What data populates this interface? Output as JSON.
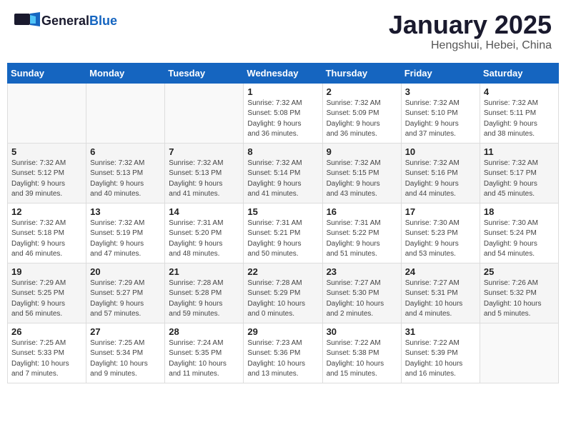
{
  "header": {
    "logo_general": "General",
    "logo_blue": "Blue",
    "month_title": "January 2025",
    "location": "Hengshui, Hebei, China"
  },
  "days_of_week": [
    "Sunday",
    "Monday",
    "Tuesday",
    "Wednesday",
    "Thursday",
    "Friday",
    "Saturday"
  ],
  "weeks": [
    [
      {
        "day": "",
        "info": ""
      },
      {
        "day": "",
        "info": ""
      },
      {
        "day": "",
        "info": ""
      },
      {
        "day": "1",
        "info": "Sunrise: 7:32 AM\nSunset: 5:08 PM\nDaylight: 9 hours\nand 36 minutes."
      },
      {
        "day": "2",
        "info": "Sunrise: 7:32 AM\nSunset: 5:09 PM\nDaylight: 9 hours\nand 36 minutes."
      },
      {
        "day": "3",
        "info": "Sunrise: 7:32 AM\nSunset: 5:10 PM\nDaylight: 9 hours\nand 37 minutes."
      },
      {
        "day": "4",
        "info": "Sunrise: 7:32 AM\nSunset: 5:11 PM\nDaylight: 9 hours\nand 38 minutes."
      }
    ],
    [
      {
        "day": "5",
        "info": "Sunrise: 7:32 AM\nSunset: 5:12 PM\nDaylight: 9 hours\nand 39 minutes."
      },
      {
        "day": "6",
        "info": "Sunrise: 7:32 AM\nSunset: 5:13 PM\nDaylight: 9 hours\nand 40 minutes."
      },
      {
        "day": "7",
        "info": "Sunrise: 7:32 AM\nSunset: 5:13 PM\nDaylight: 9 hours\nand 41 minutes."
      },
      {
        "day": "8",
        "info": "Sunrise: 7:32 AM\nSunset: 5:14 PM\nDaylight: 9 hours\nand 41 minutes."
      },
      {
        "day": "9",
        "info": "Sunrise: 7:32 AM\nSunset: 5:15 PM\nDaylight: 9 hours\nand 43 minutes."
      },
      {
        "day": "10",
        "info": "Sunrise: 7:32 AM\nSunset: 5:16 PM\nDaylight: 9 hours\nand 44 minutes."
      },
      {
        "day": "11",
        "info": "Sunrise: 7:32 AM\nSunset: 5:17 PM\nDaylight: 9 hours\nand 45 minutes."
      }
    ],
    [
      {
        "day": "12",
        "info": "Sunrise: 7:32 AM\nSunset: 5:18 PM\nDaylight: 9 hours\nand 46 minutes."
      },
      {
        "day": "13",
        "info": "Sunrise: 7:32 AM\nSunset: 5:19 PM\nDaylight: 9 hours\nand 47 minutes."
      },
      {
        "day": "14",
        "info": "Sunrise: 7:31 AM\nSunset: 5:20 PM\nDaylight: 9 hours\nand 48 minutes."
      },
      {
        "day": "15",
        "info": "Sunrise: 7:31 AM\nSunset: 5:21 PM\nDaylight: 9 hours\nand 50 minutes."
      },
      {
        "day": "16",
        "info": "Sunrise: 7:31 AM\nSunset: 5:22 PM\nDaylight: 9 hours\nand 51 minutes."
      },
      {
        "day": "17",
        "info": "Sunrise: 7:30 AM\nSunset: 5:23 PM\nDaylight: 9 hours\nand 53 minutes."
      },
      {
        "day": "18",
        "info": "Sunrise: 7:30 AM\nSunset: 5:24 PM\nDaylight: 9 hours\nand 54 minutes."
      }
    ],
    [
      {
        "day": "19",
        "info": "Sunrise: 7:29 AM\nSunset: 5:25 PM\nDaylight: 9 hours\nand 56 minutes."
      },
      {
        "day": "20",
        "info": "Sunrise: 7:29 AM\nSunset: 5:27 PM\nDaylight: 9 hours\nand 57 minutes."
      },
      {
        "day": "21",
        "info": "Sunrise: 7:28 AM\nSunset: 5:28 PM\nDaylight: 9 hours\nand 59 minutes."
      },
      {
        "day": "22",
        "info": "Sunrise: 7:28 AM\nSunset: 5:29 PM\nDaylight: 10 hours\nand 0 minutes."
      },
      {
        "day": "23",
        "info": "Sunrise: 7:27 AM\nSunset: 5:30 PM\nDaylight: 10 hours\nand 2 minutes."
      },
      {
        "day": "24",
        "info": "Sunrise: 7:27 AM\nSunset: 5:31 PM\nDaylight: 10 hours\nand 4 minutes."
      },
      {
        "day": "25",
        "info": "Sunrise: 7:26 AM\nSunset: 5:32 PM\nDaylight: 10 hours\nand 5 minutes."
      }
    ],
    [
      {
        "day": "26",
        "info": "Sunrise: 7:25 AM\nSunset: 5:33 PM\nDaylight: 10 hours\nand 7 minutes."
      },
      {
        "day": "27",
        "info": "Sunrise: 7:25 AM\nSunset: 5:34 PM\nDaylight: 10 hours\nand 9 minutes."
      },
      {
        "day": "28",
        "info": "Sunrise: 7:24 AM\nSunset: 5:35 PM\nDaylight: 10 hours\nand 11 minutes."
      },
      {
        "day": "29",
        "info": "Sunrise: 7:23 AM\nSunset: 5:36 PM\nDaylight: 10 hours\nand 13 minutes."
      },
      {
        "day": "30",
        "info": "Sunrise: 7:22 AM\nSunset: 5:38 PM\nDaylight: 10 hours\nand 15 minutes."
      },
      {
        "day": "31",
        "info": "Sunrise: 7:22 AM\nSunset: 5:39 PM\nDaylight: 10 hours\nand 16 minutes."
      },
      {
        "day": "",
        "info": ""
      }
    ]
  ]
}
